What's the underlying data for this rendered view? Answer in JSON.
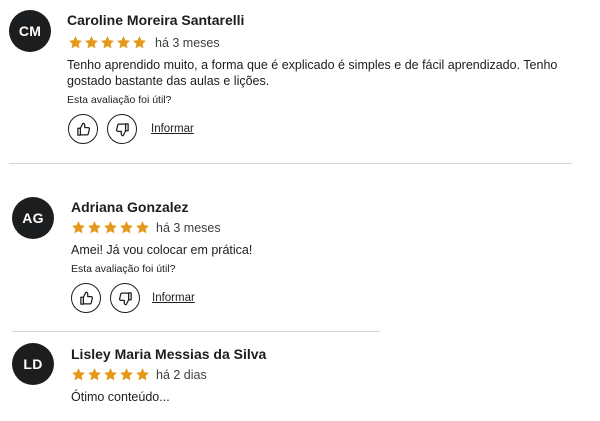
{
  "colors": {
    "star": "#e59819",
    "avatar_bg": "#1c1d1f",
    "text": "#1c1d1f",
    "divider": "#d1d2e0"
  },
  "reviews": [
    {
      "initials": "CM",
      "name": "Caroline Moreira Santarelli",
      "rating": 5,
      "time": "há 3 meses",
      "text": "Tenho aprendido muito, a forma que é explicado é simples e de fácil aprendizado. Tenho gostado bastante das aulas e lições.",
      "helpful_question": "Esta avaliação foi útil?",
      "like_icon": "thumbs-up-icon",
      "dislike_icon": "thumbs-down-icon",
      "report_label": "Informar"
    },
    {
      "initials": "AG",
      "name": "Adriana Gonzalez",
      "rating": 5,
      "time": "há 3 meses",
      "text": "Amei! Já vou colocar em prática!",
      "helpful_question": "Esta avaliação foi útil?",
      "like_icon": "thumbs-up-icon",
      "dislike_icon": "thumbs-down-icon",
      "report_label": "Informar"
    },
    {
      "initials": "LD",
      "name": "Lisley Maria Messias da Silva",
      "rating": 5,
      "time": "há 2 dias",
      "text": "Ótimo conteúdo..."
    }
  ]
}
